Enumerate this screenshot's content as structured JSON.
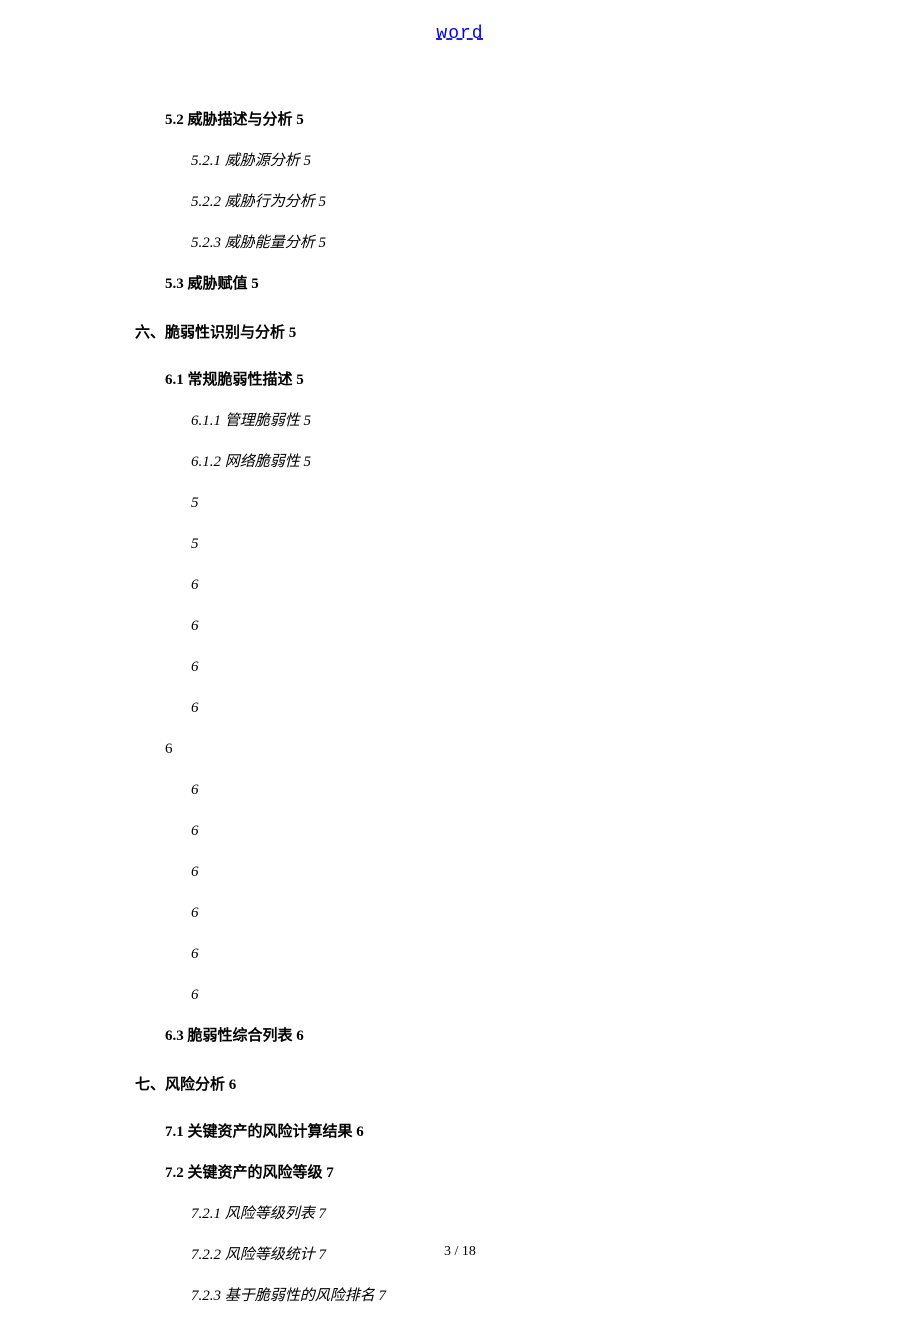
{
  "header": {
    "link_text": "word"
  },
  "toc": [
    {
      "cls": "h2",
      "bold": true,
      "text": "5.2 威胁描述与分析 5"
    },
    {
      "cls": "h3",
      "bold": false,
      "text": "5.2.1 威胁源分析 5"
    },
    {
      "cls": "h3",
      "bold": false,
      "text": "5.2.2 威胁行为分析 5"
    },
    {
      "cls": "h3",
      "bold": false,
      "text": "5.2.3 威胁能量分析 5"
    },
    {
      "cls": "h2",
      "bold": true,
      "text": "5.3 威胁赋值 5"
    },
    {
      "cls": "h1",
      "bold": true,
      "text": "六、脆弱性识别与分析 5"
    },
    {
      "cls": "h2",
      "bold": true,
      "text": "6.1 常规脆弱性描述 5"
    },
    {
      "cls": "h3",
      "bold": false,
      "text": "6.1.1 管理脆弱性 5"
    },
    {
      "cls": "h3",
      "bold": false,
      "text": "6.1.2 网络脆弱性 5"
    },
    {
      "cls": "h3 num-only",
      "bold": false,
      "text": "5"
    },
    {
      "cls": "h3 num-only",
      "bold": false,
      "text": "5"
    },
    {
      "cls": "h3 num-only",
      "bold": false,
      "text": "6"
    },
    {
      "cls": "h3 num-only",
      "bold": false,
      "text": "6"
    },
    {
      "cls": "h3 num-only",
      "bold": false,
      "text": "6"
    },
    {
      "cls": "h3 num-only",
      "bold": false,
      "text": "6"
    },
    {
      "cls": "h2",
      "bold": false,
      "text": "6"
    },
    {
      "cls": "h3 num-only",
      "bold": false,
      "text": "6"
    },
    {
      "cls": "h3 num-only",
      "bold": false,
      "text": "6"
    },
    {
      "cls": "h3 num-only",
      "bold": false,
      "text": "6"
    },
    {
      "cls": "h3 num-only",
      "bold": false,
      "text": "6"
    },
    {
      "cls": "h3 num-only",
      "bold": false,
      "text": "6"
    },
    {
      "cls": "h3 num-only",
      "bold": false,
      "text": "6"
    },
    {
      "cls": "h2",
      "bold": true,
      "text": "6.3 脆弱性综合列表 6"
    },
    {
      "cls": "h1",
      "bold": true,
      "text": "七、风险分析 6"
    },
    {
      "cls": "h2",
      "bold": true,
      "text": "7.1 关键资产的风险计算结果 6"
    },
    {
      "cls": "h2",
      "bold": true,
      "text": "7.2 关键资产的风险等级 7"
    },
    {
      "cls": "h3",
      "bold": false,
      "text": "7.2.1 风险等级列表 7"
    },
    {
      "cls": "h3",
      "bold": false,
      "text": "7.2.2 风险等级统计 7"
    },
    {
      "cls": "h3",
      "bold": false,
      "text": "7.2.3 基于脆弱性的风险排名 7"
    }
  ],
  "footer": {
    "page_number": "3 / 18"
  }
}
